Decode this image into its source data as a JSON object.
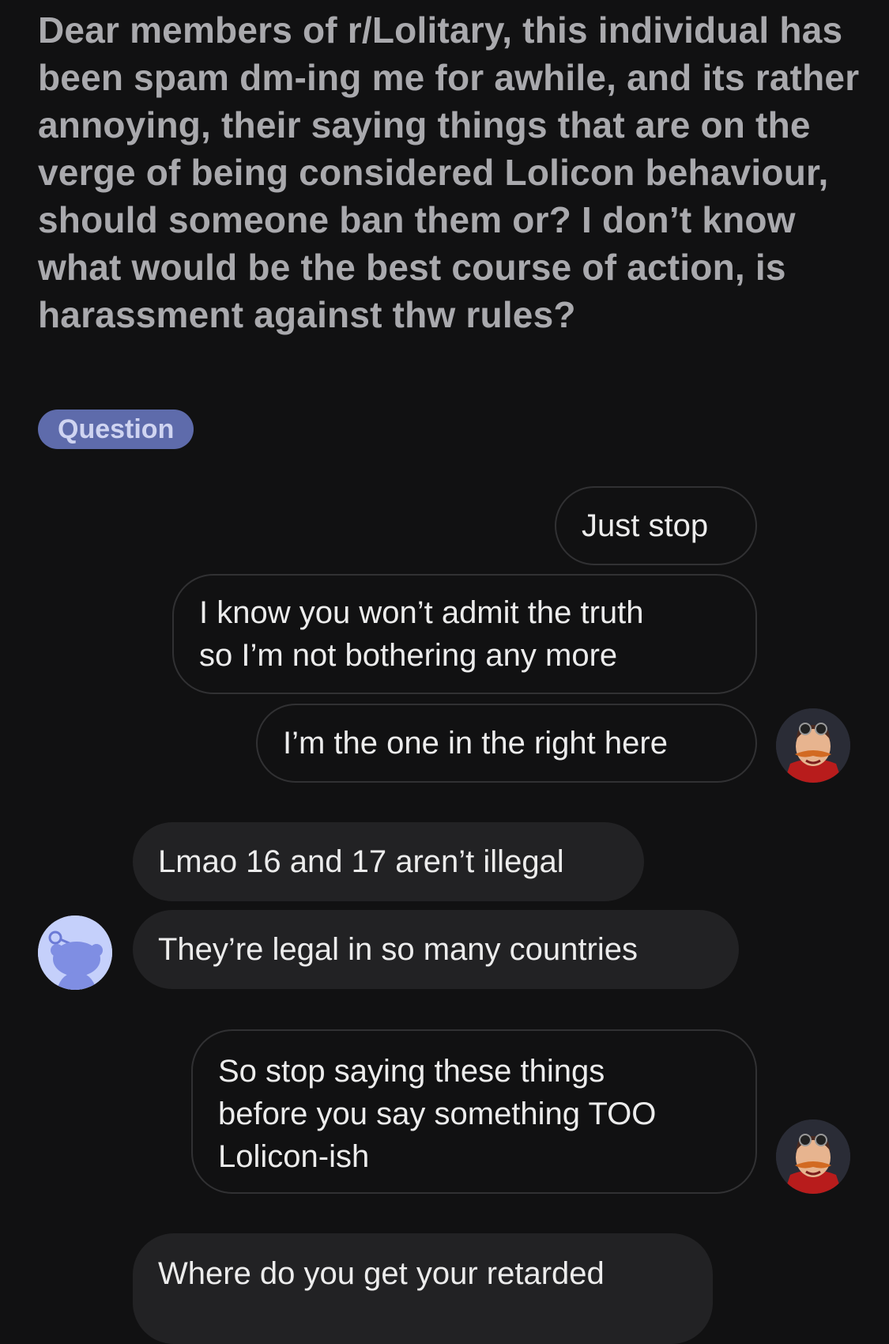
{
  "post": {
    "body": "Dear members of r/Lolitary, this individual has been spam dm-ing me for awhile, and its rather annoying, their saying things that are on the verge of being considered Lolicon behaviour, should someone ban them or? I don’t know what would be the best course of action, is harassment against thw rules?",
    "flair": "Question"
  },
  "chat": {
    "messages": [
      {
        "text_lines": [
          "Just stop"
        ]
      },
      {
        "text_lines": [
          "I know you won’t admit the truth",
          "so I’m not bothering any more"
        ]
      },
      {
        "text_lines": [
          "I’m the one in the right here"
        ]
      },
      {
        "text_lines": [
          "Lmao 16 and 17 aren’t illegal"
        ]
      },
      {
        "text_lines": [
          "They’re legal in so many countries"
        ]
      },
      {
        "text_lines": [
          "So stop saying these things",
          "before you say something TOO",
          "Lolicon-ish"
        ]
      },
      {
        "text_lines": [
          "Where do you get your retarded"
        ]
      }
    ]
  },
  "colors": {
    "background": "#111112",
    "post_text": "#a9a9ad",
    "flair_bg": "#5e6bab",
    "received_bubble": "#222224",
    "sent_bubble_border": "#313133"
  },
  "icons": {
    "sender_avatar": "robotnik-avatar-icon",
    "recipient_avatar": "reddit-snoo-avatar-icon"
  }
}
